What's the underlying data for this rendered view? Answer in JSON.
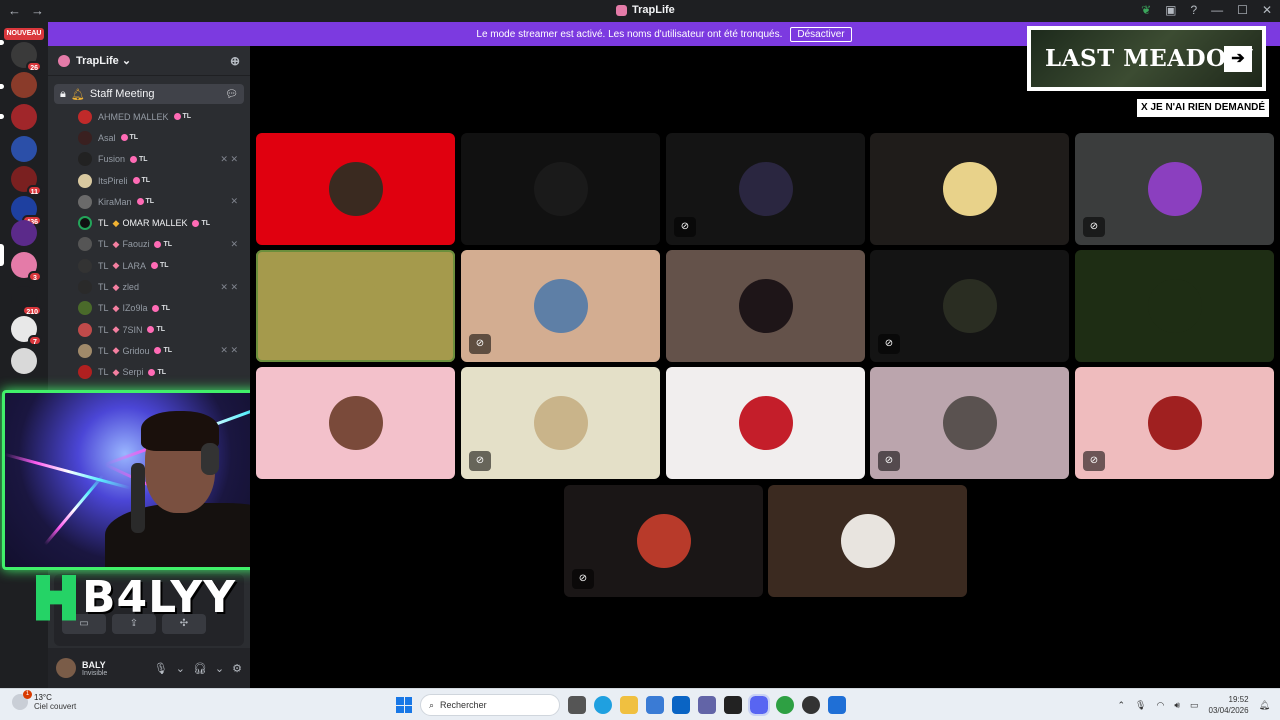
{
  "window": {
    "title": "TrapLife",
    "nav_back": "←",
    "nav_forward": "→",
    "controls": [
      "—",
      "☐",
      "✕"
    ]
  },
  "banner": {
    "text": "Le mode streamer est activé. Les noms d'utilisateur ont été tronqués.",
    "button": "Désactiver"
  },
  "server_list": {
    "new_badge": "NOUVEAU",
    "servers": [
      {
        "color": "#3a3a3a",
        "badge": "26"
      },
      {
        "color": "#8a3b2a",
        "badge": ""
      },
      {
        "color": "#a0262a",
        "badge": ""
      },
      {
        "color": "#2b4fa8",
        "badge": ""
      },
      {
        "color": "#7a2020",
        "badge": "11"
      },
      {
        "color": "#1e40a0",
        "badge": "436"
      },
      {
        "color": "#5b2a8a",
        "badge": ""
      },
      {
        "color": "#e47ba8",
        "badge": "3"
      },
      {
        "color": "#1e1f22",
        "badge": "210"
      },
      {
        "color": "#e8e8e8",
        "badge": "7"
      },
      {
        "color": "#d9d9d9",
        "badge": ""
      }
    ]
  },
  "guild": {
    "name": "TrapLife",
    "channel": "Staff Meeting",
    "members": [
      {
        "name": "AHMED MALLEK",
        "prefix": "",
        "tag": "TL",
        "muted": ""
      },
      {
        "name": "Asal",
        "prefix": "",
        "tag": "TL",
        "muted": ""
      },
      {
        "name": "Fusion",
        "prefix": "",
        "tag": "TL",
        "muted": "✕ ✕"
      },
      {
        "name": "ItsPireli",
        "prefix": "",
        "tag": "TL",
        "muted": ""
      },
      {
        "name": "KiraMan",
        "prefix": "",
        "tag": "TL",
        "muted": "✕"
      },
      {
        "name": "OMAR MALLEK",
        "prefix": "TL",
        "tag": "TL",
        "muted": ""
      },
      {
        "name": "Faouzi",
        "prefix": "TL",
        "tag": "TL",
        "muted": "✕"
      },
      {
        "name": "LARA",
        "prefix": "TL",
        "tag": "TL",
        "muted": ""
      },
      {
        "name": "zled",
        "prefix": "TL",
        "tag": "",
        "muted": "✕ ✕"
      },
      {
        "name": "IZo9la",
        "prefix": "TL",
        "tag": "TL",
        "muted": ""
      },
      {
        "name": "7SIN",
        "prefix": "TL",
        "tag": "TL",
        "muted": ""
      },
      {
        "name": "Gridou",
        "prefix": "TL",
        "tag": "TL",
        "muted": "✕ ✕"
      },
      {
        "name": "Serpi",
        "prefix": "TL",
        "tag": "TL",
        "muted": ""
      }
    ]
  },
  "user": {
    "name": "BALY",
    "status": "Invisible"
  },
  "streamer": {
    "brand": "B4LYY"
  },
  "overlay": {
    "title": "LAST MEADOW",
    "arrow": "➔",
    "subtitle": "X JE N'AI RIEN DEMANDÉ"
  },
  "tiles": [
    {
      "bg": "#e0000f",
      "avatar": "#3a2a20",
      "muted": ""
    },
    {
      "bg": "#111111",
      "avatar": "#1a1a1a",
      "muted": ""
    },
    {
      "bg": "#141414",
      "avatar": "#2a2640",
      "muted": "⊘"
    },
    {
      "bg": "#1f1c1a",
      "avatar": "#e8d28a",
      "muted": ""
    },
    {
      "bg": "#3b3d3d",
      "avatar": "#8b3fbf",
      "muted": "⊘"
    },
    {
      "bg": "#a59a4c",
      "avatar": "#a59a4c",
      "muted": ""
    },
    {
      "bg": "#d3ad91",
      "avatar": "#5e7fa6",
      "muted": "⊘"
    },
    {
      "bg": "#64524a",
      "avatar": "#1e1518",
      "muted": ""
    },
    {
      "bg": "#141414",
      "avatar": "#2a2d22",
      "muted": "⊘"
    },
    {
      "bg": "#1e2d14",
      "avatar": "#1e2d14",
      "muted": ""
    },
    {
      "bg": "#f3c1cb",
      "avatar": "#7a4a3a",
      "muted": ""
    },
    {
      "bg": "#e4e0c8",
      "avatar": "#c9b48a",
      "muted": "⊘"
    },
    {
      "bg": "#f1eeee",
      "avatar": "#c41e2a",
      "muted": ""
    },
    {
      "bg": "#bba5ad",
      "avatar": "#5a5250",
      "muted": "⊘"
    },
    {
      "bg": "#efbcbe",
      "avatar": "#a02020",
      "muted": "⊘"
    },
    {
      "bg": "#1a1616",
      "avatar": "#b83a2a",
      "muted": "⊘"
    },
    {
      "bg": "#3b2a20",
      "avatar": "#e8e4df",
      "muted": ""
    }
  ],
  "taskbar": {
    "temperature": "13°C",
    "weather": "Ciel couvert",
    "notif": "1",
    "search_placeholder": "Rechercher",
    "time": "19:52",
    "date": "03/04/2026"
  }
}
